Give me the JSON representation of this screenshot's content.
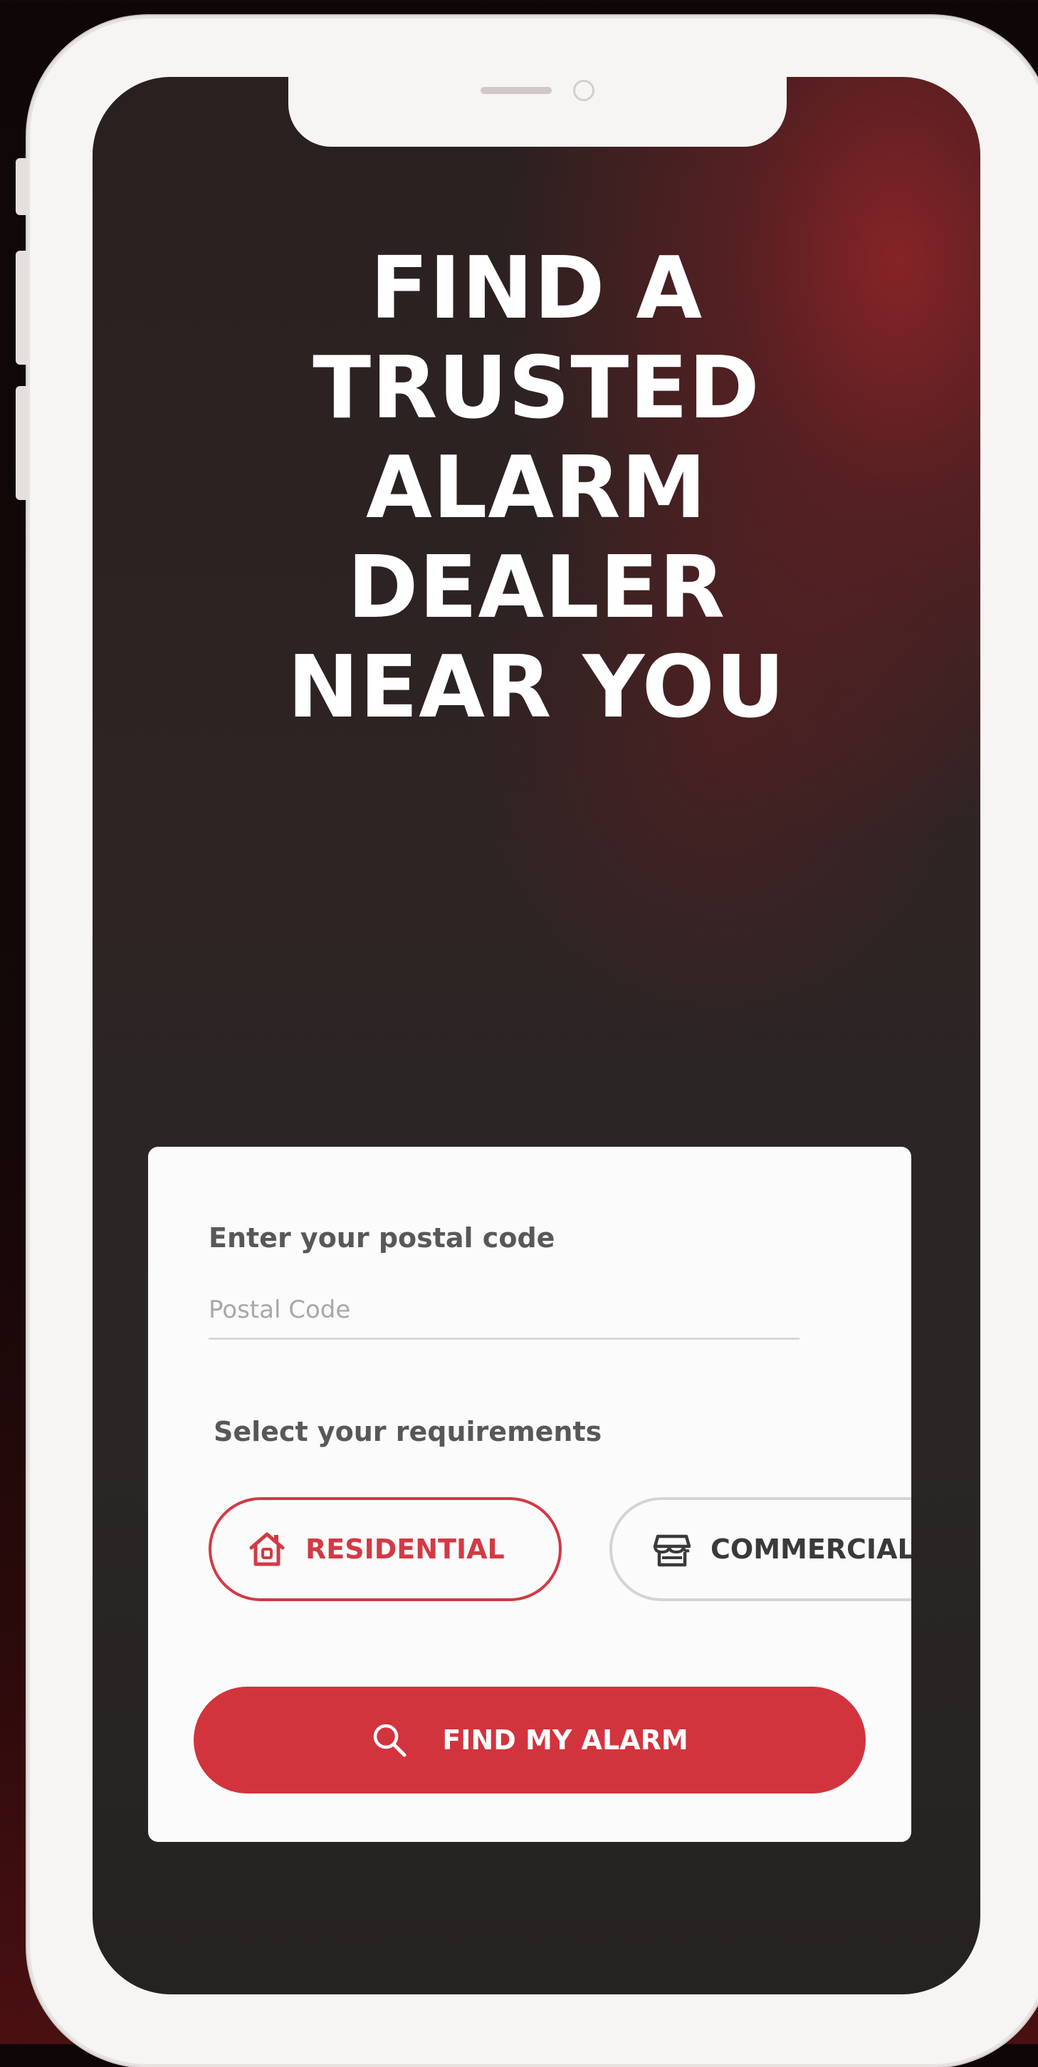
{
  "hero": {
    "headline_lines": [
      "FIND A",
      "TRUSTED",
      "ALARM",
      "DEALER",
      "NEAR YOU"
    ]
  },
  "form": {
    "postal_label": "Enter your postal code",
    "postal_placeholder": "Postal Code",
    "postal_value": "",
    "requirements_label": "Select your requirements",
    "options": [
      {
        "label": "RESIDENTIAL",
        "icon": "house-icon",
        "selected": true
      },
      {
        "label": "COMMERCIAL",
        "icon": "storefront-icon",
        "selected": false
      }
    ],
    "submit_label": "FIND MY ALARM",
    "submit_icon": "search-icon"
  },
  "colors": {
    "accent": "#d2343e",
    "card_bg": "#fbfbfb",
    "screen_bg": "#2a2424"
  }
}
